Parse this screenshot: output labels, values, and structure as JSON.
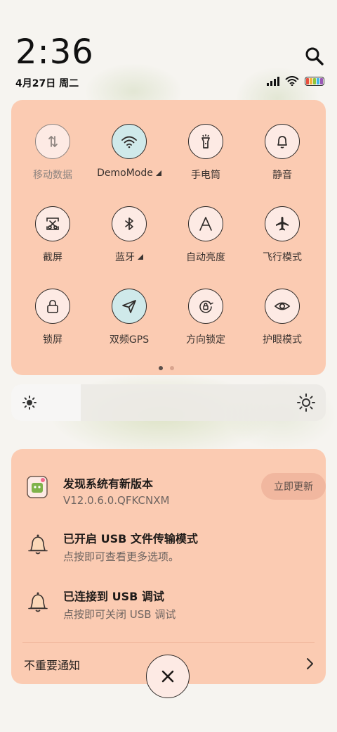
{
  "status": {
    "time": "2:36",
    "date": "4月27日 周二"
  },
  "icons": {
    "search": "search-icon",
    "signal": "signal-icon",
    "wifi": "wifi-icon",
    "battery": "battery-icon"
  },
  "quick_settings": {
    "tiles": [
      {
        "label": "移动数据",
        "icon": "mobile-data-icon",
        "active": false,
        "disabled": true
      },
      {
        "label": "DemoMode",
        "icon": "wifi-icon",
        "active": true,
        "expandable": true
      },
      {
        "label": "手电筒",
        "icon": "flashlight-icon",
        "active": false
      },
      {
        "label": "静音",
        "icon": "bell-icon",
        "active": false
      },
      {
        "label": "截屏",
        "icon": "screenshot-icon",
        "active": false
      },
      {
        "label": "蓝牙",
        "icon": "bluetooth-icon",
        "active": false,
        "expandable": true
      },
      {
        "label": "自动亮度",
        "icon": "auto-brightness-icon",
        "active": false
      },
      {
        "label": "飞行模式",
        "icon": "airplane-icon",
        "active": false
      },
      {
        "label": "锁屏",
        "icon": "lock-icon",
        "active": false
      },
      {
        "label": "双频GPS",
        "icon": "location-arrow-icon",
        "active": true
      },
      {
        "label": "方向锁定",
        "icon": "rotation-lock-icon",
        "active": false
      },
      {
        "label": "护眼模式",
        "icon": "eye-icon",
        "active": false
      }
    ],
    "page_index": 1,
    "page_count": 2
  },
  "brightness": {
    "level": 0.22
  },
  "notifications": [
    {
      "title": "发现系统有新版本",
      "subtitle": "V12.0.6.0.QFKCNXM",
      "icon": "system-update-icon",
      "action": "立即更新"
    },
    {
      "title": "已开启 USB 文件传输模式",
      "subtitle": "点按即可查看更多选项。",
      "icon": "bell-icon"
    },
    {
      "title": "已连接到 USB 调试",
      "subtitle": "点按即可关闭 USB 调试",
      "icon": "bell-icon"
    }
  ],
  "unimportant_label": "不重要通知",
  "colors": {
    "panel_bg": "#fbcbb2",
    "tile_bg": "#fdeae4",
    "tile_active_bg": "#cfe9ea",
    "accent_text": "#1e1a18"
  }
}
